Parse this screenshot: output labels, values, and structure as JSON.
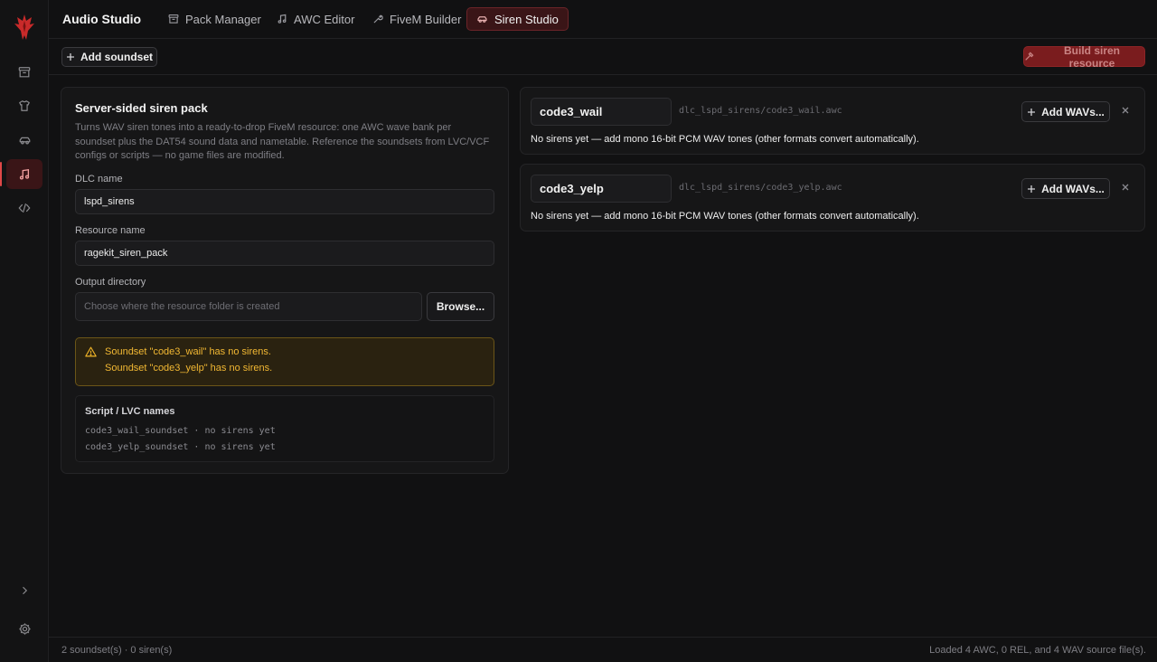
{
  "app": {
    "title": "Audio Studio"
  },
  "tabs": [
    {
      "label": "Pack Manager",
      "icon": "archive-icon"
    },
    {
      "label": "AWC Editor",
      "icon": "music-note-icon"
    },
    {
      "label": "FiveM Builder",
      "icon": "wrench-icon"
    },
    {
      "label": "Siren Studio",
      "icon": "car-icon",
      "active": true
    }
  ],
  "toolbar": {
    "add_soundset_label": "Add soundset",
    "build_label": "Build siren resource"
  },
  "panel": {
    "title": "Server-sided siren pack",
    "description": "Turns WAV siren tones into a ready-to-drop FiveM resource: one AWC wave bank per soundset plus the DAT54 sound data and nametable. Reference the soundsets from LVC/VCF configs or scripts — no game files are modified.",
    "dlc_label": "DLC name",
    "dlc_value": "lspd_sirens",
    "resource_label": "Resource name",
    "resource_value": "ragekit_siren_pack",
    "output_label": "Output directory",
    "output_placeholder": "Choose where the resource folder is created",
    "browse_label": "Browse..."
  },
  "warnings": [
    "Soundset \"code3_wail\" has no sirens.",
    "Soundset \"code3_yelp\" has no sirens."
  ],
  "script_names": {
    "title": "Script / LVC names",
    "lines": [
      "code3_wail_soundset · no sirens yet",
      "code3_yelp_soundset · no sirens yet"
    ]
  },
  "soundsets": [
    {
      "name": "code3_wail",
      "path": "dlc_lspd_sirens/code3_wail.awc",
      "add_label": "Add WAVs...",
      "hint": "No sirens yet — add mono 16-bit PCM WAV tones (other formats convert automatically)."
    },
    {
      "name": "code3_yelp",
      "path": "dlc_lspd_sirens/code3_yelp.awc",
      "add_label": "Add WAVs...",
      "hint": "No sirens yet — add mono 16-bit PCM WAV tones (other formats convert automatically)."
    }
  ],
  "status": {
    "left": "2 soundset(s) · 0 siren(s)",
    "right": "Loaded 4 AWC, 0 REL, and 4 WAV source file(s)."
  },
  "colors": {
    "accent": "#e04848",
    "active_tab_bg": "#3a1517",
    "build_button_bg": "#7a1c1e",
    "warning_text": "#f2b833",
    "warning_bg": "#2a2210"
  }
}
